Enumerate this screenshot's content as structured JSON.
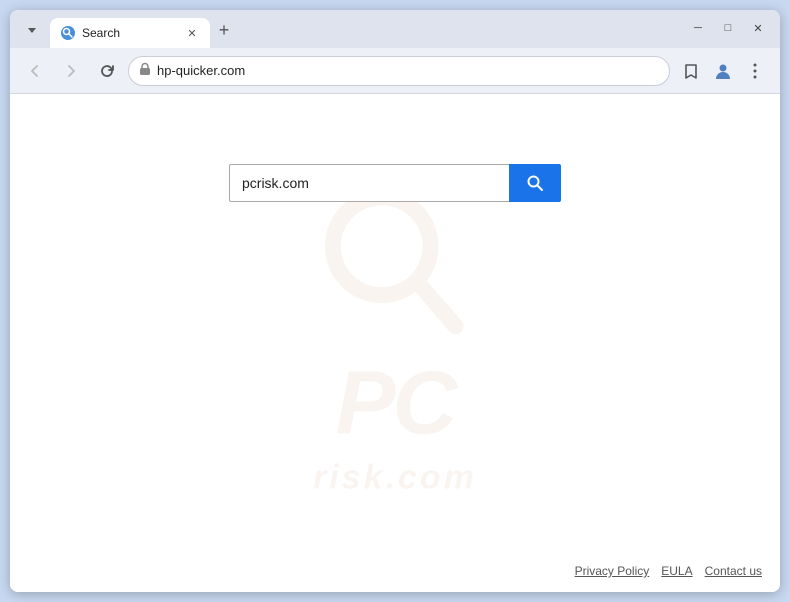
{
  "browser": {
    "tab": {
      "title": "Search",
      "favicon": "🔵"
    },
    "new_tab_label": "+",
    "window_controls": {
      "minimize": "─",
      "maximize": "□",
      "close": "✕"
    },
    "nav": {
      "back_disabled": true,
      "forward_disabled": true,
      "url": "hp-quicker.com",
      "lock_icon": "🔒"
    }
  },
  "page": {
    "search_input_value": "pcrisk.com",
    "search_button_icon": "search",
    "watermark_letters": "PC",
    "footer": {
      "links": [
        {
          "label": "Privacy Policy",
          "id": "privacy-policy"
        },
        {
          "label": "EULA",
          "id": "eula"
        },
        {
          "label": "Contact us",
          "id": "contact-us"
        }
      ]
    }
  },
  "colors": {
    "accent": "#1a73e8",
    "watermark": "#e08060",
    "tab_bg": "#ffffff",
    "titlebar_bg": "#dee3ed",
    "navbar_bg": "#edf0f7"
  }
}
